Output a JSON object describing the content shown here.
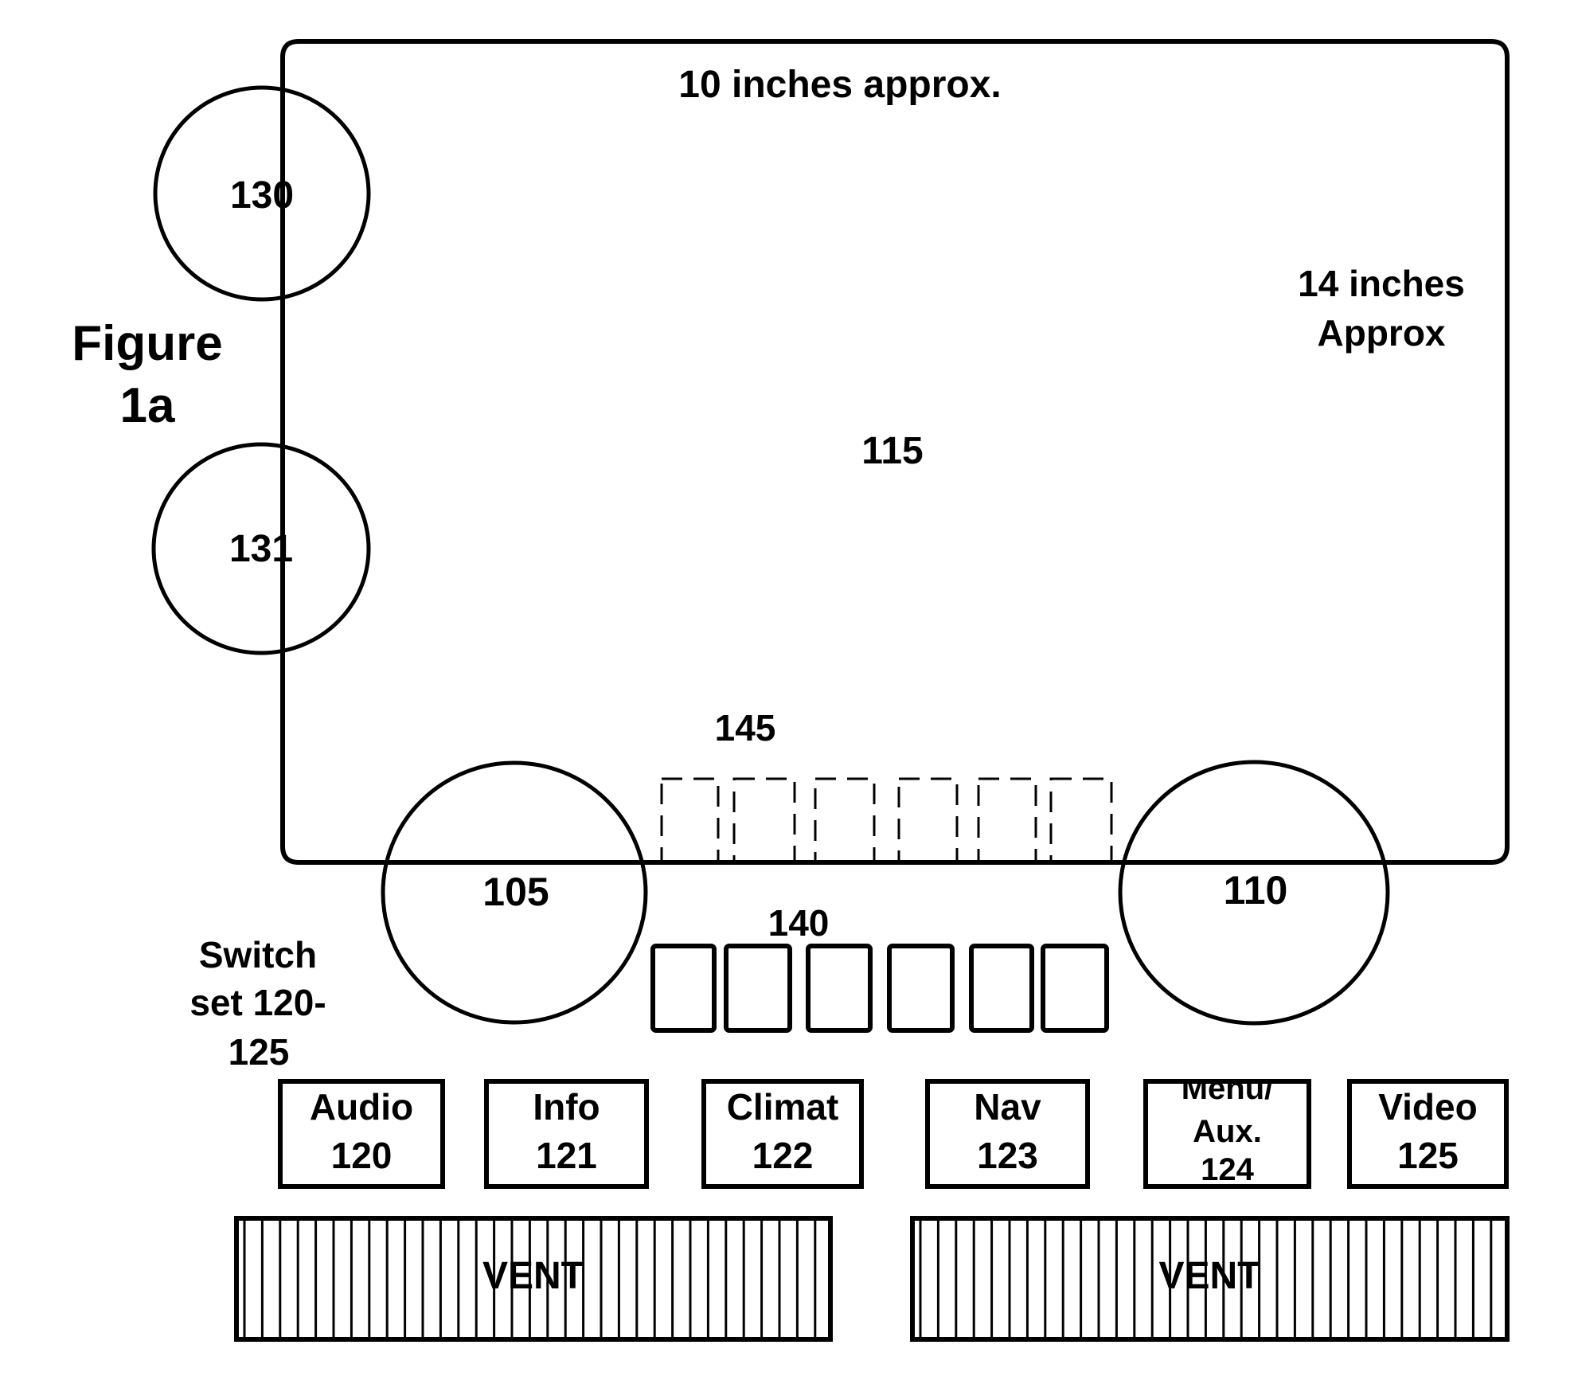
{
  "figure": {
    "title_line1": "Figure",
    "title_line2": "1a",
    "line_color": "#000000",
    "background": "#ffffff"
  },
  "screen": {
    "id_label": "115",
    "width_label": "10 inches approx.",
    "height_label_line1": "14 inches",
    "height_label_line2": "Approx"
  },
  "knobs": [
    {
      "id": "130",
      "label": "130"
    },
    {
      "id": "131",
      "label": "131"
    },
    {
      "id": "105",
      "label": "105"
    },
    {
      "id": "110",
      "label": "110"
    }
  ],
  "soft_buttons": {
    "label": "145",
    "count": 6,
    "style": "dashed"
  },
  "hard_buttons": {
    "label": "140",
    "count": 6,
    "style": "solid"
  },
  "switch_set": {
    "caption_line1": "Switch",
    "caption_line2": "set 120-",
    "caption_line3": "125",
    "switches": [
      {
        "name": "audio",
        "lines": [
          "Audio",
          "120"
        ]
      },
      {
        "name": "info",
        "lines": [
          "Info",
          "121"
        ]
      },
      {
        "name": "climate",
        "lines": [
          "Climat",
          "122"
        ]
      },
      {
        "name": "nav",
        "lines": [
          "Nav",
          "123"
        ]
      },
      {
        "name": "menu-aux",
        "lines": [
          "Menu/",
          "Aux.",
          "124"
        ]
      },
      {
        "name": "video",
        "lines": [
          "Video",
          "125"
        ]
      }
    ]
  },
  "vents": [
    {
      "label": "VENT"
    },
    {
      "label": "VENT"
    }
  ]
}
